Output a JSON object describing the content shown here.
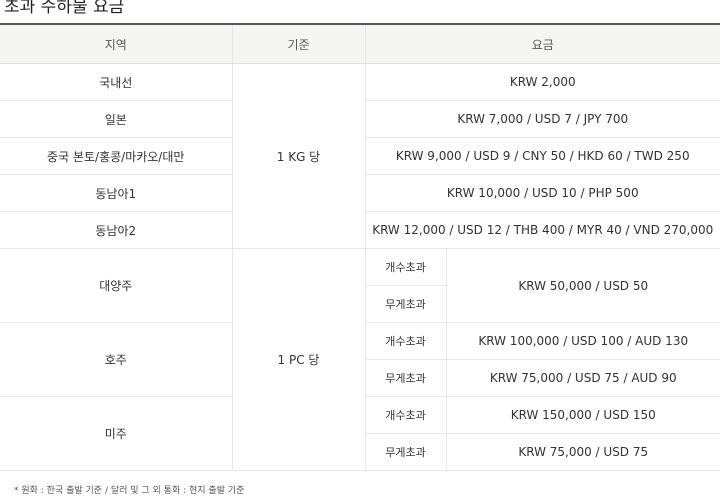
{
  "title": "초과 수하물 요금",
  "table": {
    "headers": {
      "region": "지역",
      "basis": "기준",
      "fee": "요금"
    },
    "kg_basis": "1 KG 당",
    "pc_basis": "1 PC 당",
    "kg_rows": [
      {
        "region": "국내선",
        "fee": "KRW 2,000"
      },
      {
        "region": "일본",
        "fee": "KRW 7,000 / USD 7 / JPY 700"
      },
      {
        "region": "중국 본토/홍콩/마카오/대만",
        "fee": "KRW 9,000 / USD 9 / CNY 50 / HKD 60 / TWD 250"
      },
      {
        "region": "동남아1",
        "fee": "KRW 10,000 / USD 10 / PHP 500"
      },
      {
        "region": "동남아2",
        "fee": "KRW 12,000 / USD 12 / THB 400 / MYR 40 / VND 270,000"
      }
    ],
    "pc_rows": [
      {
        "region": "대양주",
        "count_label": "개수초과",
        "weight_label": "무게초과",
        "shared_fee": "KRW 50,000 / USD 50"
      },
      {
        "region": "호주",
        "count_label": "개수초과",
        "count_fee": "KRW 100,000 / USD 100 / AUD 130",
        "weight_label": "무게초과",
        "weight_fee": "KRW 75,000 / USD 75 / AUD 90"
      },
      {
        "region": "미주",
        "count_label": "개수초과",
        "count_fee": "KRW 150,000 / USD 150",
        "weight_label": "무게초과",
        "weight_fee": "KRW 75,000 / USD 75"
      }
    ]
  },
  "footnote": "* 원화 : 한국 출발 기준 / 달러 및 그 외 통화 : 현지 출발 기준"
}
